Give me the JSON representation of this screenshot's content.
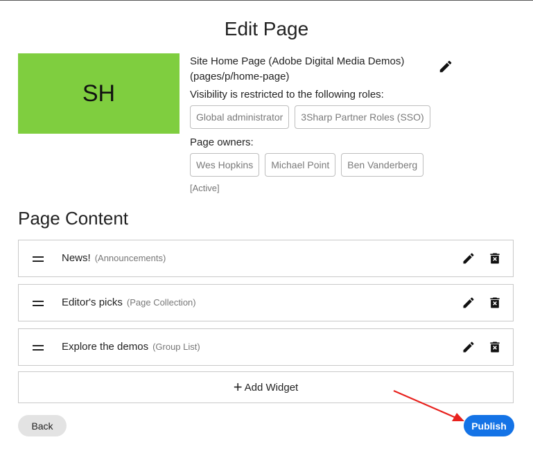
{
  "page": {
    "title": "Edit Page"
  },
  "avatar": {
    "initials": "SH",
    "color": "#7fce3f"
  },
  "page_info": {
    "name": "Site Home Page (Adobe Digital Media Demos)",
    "path": "(pages/p/home-page)",
    "visibility_label": "Visibility is restricted to the following roles:",
    "roles": [
      "Global administrator",
      "3Sharp Partner Roles (SSO)"
    ],
    "owners_label": "Page owners:",
    "owners": [
      "Wes Hopkins",
      "Michael Point",
      "Ben Vanderberg"
    ],
    "status": "[Active]"
  },
  "content": {
    "title": "Page Content",
    "widgets": [
      {
        "name": "News!",
        "type": "(Announcements)"
      },
      {
        "name": "Editor's picks",
        "type": "(Page Collection)"
      },
      {
        "name": "Explore the demos",
        "type": "(Group List)"
      }
    ],
    "add_label": "Add Widget"
  },
  "actions": {
    "back": "Back",
    "publish": "Publish"
  },
  "colors": {
    "publish": "#1473e6",
    "annotation_arrow": "#e8221e"
  },
  "icons": [
    "pencil-icon",
    "trash-icon",
    "drag-handle-icon",
    "plus-icon",
    "arrow-annotation"
  ]
}
